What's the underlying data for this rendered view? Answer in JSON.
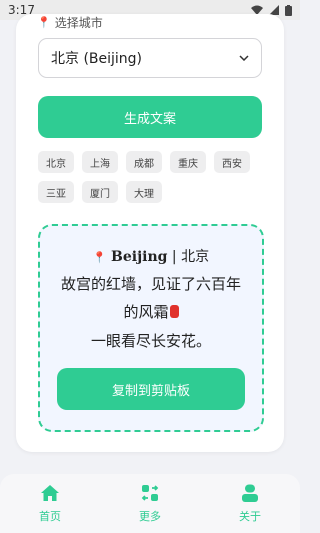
{
  "status_bar": {
    "time": "3:17"
  },
  "city_picker": {
    "label": "选择城市",
    "selected": "北京 (Beijing)"
  },
  "actions": {
    "generate_label": "生成文案",
    "copy_label": "复制到剪贴板"
  },
  "city_chips": [
    "北京",
    "上海",
    "成都",
    "重庆",
    "西安",
    "三亚",
    "厦门",
    "大理"
  ],
  "result": {
    "title_en": "Beijing",
    "title_sep": " | ",
    "title_zh": "北京",
    "lines": [
      "故宫的红墙，见证了六百年",
      "的风霜",
      "一眼看尽长安花。"
    ]
  },
  "bottom_nav": {
    "items": [
      {
        "label": "首页",
        "icon": "home-icon"
      },
      {
        "label": "更多",
        "icon": "more-icon"
      },
      {
        "label": "关于",
        "icon": "user-icon"
      }
    ]
  },
  "colors": {
    "accent": "#2fcc93",
    "background": "#f1f2f6",
    "pin": "#e24a3b"
  }
}
